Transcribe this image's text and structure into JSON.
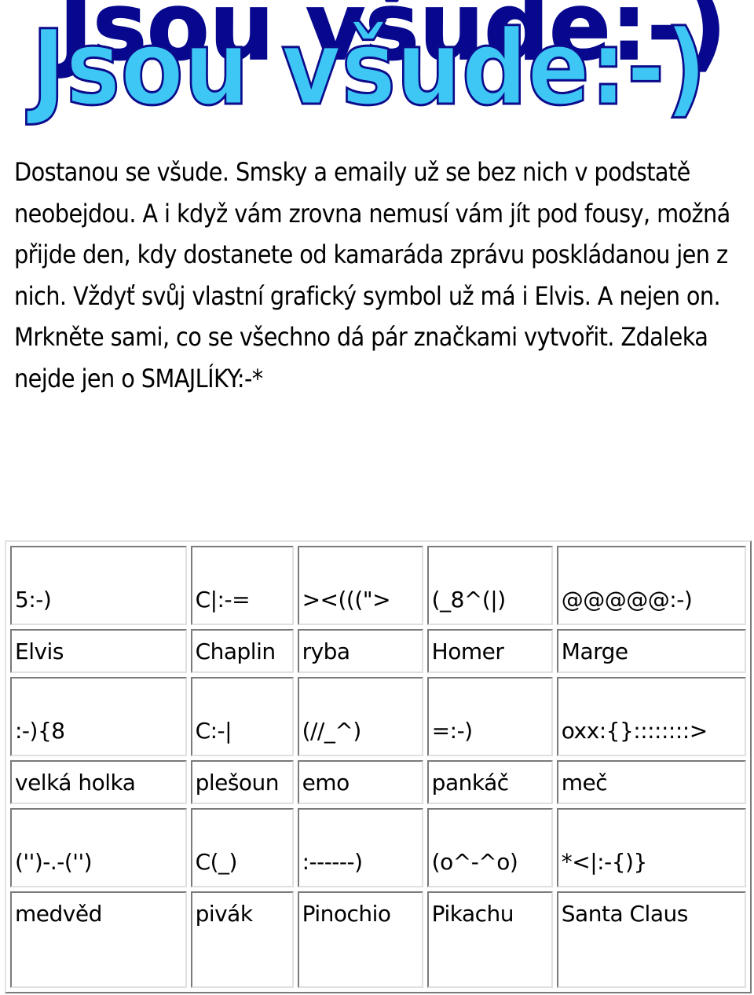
{
  "title": {
    "text": "Jsou všude:-)",
    "colors": {
      "fill": "#3ec7f5",
      "outline": "#0b0b8c",
      "shadow": "#08088f"
    }
  },
  "intro": {
    "paragraph": "Dostanou se všude. Smsky a emaily už se bez nich v podstatě neobejdou. A i když vám zrovna nemusí vám jít pod fousy, možná přijde den, kdy dostanete od kamaráda zprávu poskládanou jen z nich. Vždyť svůj vlastní grafický symbol už má i Elvis. A nejen on. Mrkněte sami, co se všechno dá pár značkami vytvořit. Zdaleka nejde jen o SMAJLÍKY:-*"
  },
  "smileys": {
    "groups": [
      {
        "items": [
          {
            "symbol": "5:-)",
            "name": "Elvis"
          },
          {
            "symbol": "C|:-=",
            "name": "Chaplin"
          },
          {
            "symbol": "><(((\">",
            "name": "ryba"
          },
          {
            "symbol": "(_8^(|)",
            "name": "Homer"
          },
          {
            "symbol": "@@@@@:-)",
            "name": "Marge"
          }
        ]
      },
      {
        "items": [
          {
            "symbol": ":-){8",
            "name": "velká holka"
          },
          {
            "symbol": "C:-|",
            "name": "plešoun"
          },
          {
            "symbol": "(//_^)",
            "name": "emo"
          },
          {
            "symbol": "=:-)",
            "name": "pankáč"
          },
          {
            "symbol": "oxx:{}::::::::>",
            "name": "meč"
          }
        ]
      },
      {
        "items": [
          {
            "symbol": "('')-.-('')",
            "name": "medvěd"
          },
          {
            "symbol": "C(_)",
            "name": "pivák"
          },
          {
            "symbol": ":------)",
            "name": "Pinochio"
          },
          {
            "symbol": "(o^-^o)",
            "name": "Pikachu"
          },
          {
            "symbol": "*<|:-{)}",
            "name": "Santa Claus"
          }
        ]
      }
    ]
  }
}
